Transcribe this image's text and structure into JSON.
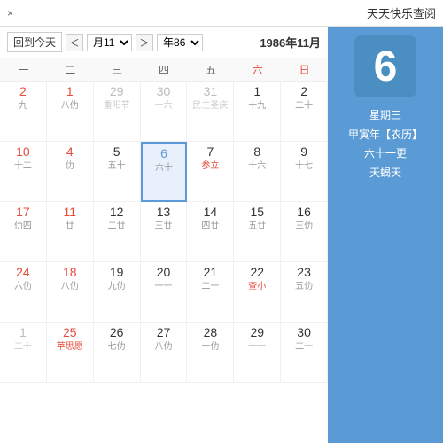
{
  "window": {
    "title": "天天快乐查阅",
    "close_label": "×"
  },
  "sidebar": {
    "big_day": "6",
    "weekday": "星期三",
    "info_line1": "【农历】甲寅年",
    "info_line2": "六十一更",
    "info_line3": "天蝎天"
  },
  "calendar": {
    "title_left": "1986年11月",
    "today_btn": "回到今天",
    "year_select": "年86",
    "month_select": "月11",
    "nav_prev": "＜",
    "nav_next": "＞",
    "weekdays": [
      {
        "label": "日",
        "is_weekend": true
      },
      {
        "label": "六",
        "is_weekend": true
      },
      {
        "label": "五",
        "is_weekend": false
      },
      {
        "label": "四",
        "is_weekend": false
      },
      {
        "label": "三",
        "is_weekend": false
      },
      {
        "label": "二",
        "is_weekend": false
      },
      {
        "label": "一",
        "is_weekend": false
      }
    ],
    "weeks": [
      [
        {
          "day": "2",
          "lunar": "二十",
          "is_weekend": false,
          "other_month": false,
          "today": false,
          "holiday": ""
        },
        {
          "day": "1",
          "lunar": "十九",
          "is_weekend": false,
          "other_month": false,
          "today": false,
          "holiday": ""
        },
        {
          "day": "31",
          "lunar": "民主圣庆",
          "is_weekend": false,
          "other_month": true,
          "today": false,
          "holiday": "民主圣庆"
        },
        {
          "day": "30",
          "lunar": "十六",
          "is_weekend": false,
          "other_month": true,
          "today": false,
          "holiday": ""
        },
        {
          "day": "29",
          "lunar": "重阳节",
          "is_weekend": false,
          "other_month": true,
          "today": false,
          "holiday": "重阳节"
        },
        {
          "day": "1",
          "lunar": "八仂",
          "is_weekend": true,
          "other_month": false,
          "today": false,
          "holiday": ""
        },
        {
          "day": "2",
          "lunar": "九",
          "is_weekend": true,
          "other_month": false,
          "today": false,
          "holiday": ""
        }
      ],
      [
        {
          "day": "9",
          "lunar": "十七",
          "is_weekend": false,
          "other_month": false,
          "today": false,
          "holiday": ""
        },
        {
          "day": "8",
          "lunar": "十六",
          "is_weekend": false,
          "other_month": false,
          "today": false,
          "holiday": ""
        },
        {
          "day": "7",
          "lunar": "参立",
          "is_weekend": false,
          "other_month": false,
          "today": false,
          "holiday": "参立"
        },
        {
          "day": "6",
          "lunar": "六十",
          "is_weekend": false,
          "other_month": false,
          "today": true,
          "holiday": ""
        },
        {
          "day": "5",
          "lunar": "五十",
          "is_weekend": false,
          "other_month": false,
          "today": false,
          "holiday": ""
        },
        {
          "day": "4",
          "lunar": "仂",
          "is_weekend": true,
          "other_month": false,
          "today": false,
          "holiday": ""
        },
        {
          "day": "10",
          "lunar": "十二",
          "is_weekend": true,
          "other_month": false,
          "today": false,
          "holiday": ""
        }
      ],
      [
        {
          "day": "16",
          "lunar": "三仂",
          "is_weekend": false,
          "other_month": false,
          "today": false,
          "holiday": ""
        },
        {
          "day": "15",
          "lunar": "五廿",
          "is_weekend": false,
          "other_month": false,
          "today": false,
          "holiday": ""
        },
        {
          "day": "14",
          "lunar": "四廿",
          "is_weekend": false,
          "other_month": false,
          "today": false,
          "holiday": ""
        },
        {
          "day": "13",
          "lunar": "三廿",
          "is_weekend": false,
          "other_month": false,
          "today": false,
          "holiday": ""
        },
        {
          "day": "12",
          "lunar": "二廿",
          "is_weekend": false,
          "other_month": false,
          "today": false,
          "holiday": ""
        },
        {
          "day": "11",
          "lunar": "廿",
          "is_weekend": true,
          "other_month": false,
          "today": false,
          "holiday": ""
        },
        {
          "day": "17",
          "lunar": "仂四",
          "is_weekend": true,
          "other_month": false,
          "today": false,
          "holiday": ""
        }
      ],
      [
        {
          "day": "23",
          "lunar": "五仂",
          "is_weekend": false,
          "other_month": false,
          "today": false,
          "holiday": ""
        },
        {
          "day": "22",
          "lunar": "查小",
          "is_weekend": false,
          "other_month": false,
          "today": false,
          "holiday": "查小"
        },
        {
          "day": "21",
          "lunar": "二一",
          "is_weekend": false,
          "other_month": false,
          "today": false,
          "holiday": ""
        },
        {
          "day": "20",
          "lunar": "一一",
          "is_weekend": false,
          "other_month": false,
          "today": false,
          "holiday": ""
        },
        {
          "day": "19",
          "lunar": "九仂",
          "is_weekend": false,
          "other_month": false,
          "today": false,
          "holiday": ""
        },
        {
          "day": "18",
          "lunar": "八仂",
          "is_weekend": true,
          "other_month": false,
          "today": false,
          "holiday": ""
        },
        {
          "day": "24",
          "lunar": "六仂",
          "is_weekend": true,
          "other_month": false,
          "today": false,
          "holiday": ""
        }
      ],
      [
        {
          "day": "30",
          "lunar": "二一",
          "is_weekend": false,
          "other_month": false,
          "today": false,
          "holiday": ""
        },
        {
          "day": "29",
          "lunar": "一一",
          "is_weekend": false,
          "other_month": false,
          "today": false,
          "holiday": ""
        },
        {
          "day": "28",
          "lunar": "十仂",
          "is_weekend": false,
          "other_month": false,
          "today": false,
          "holiday": ""
        },
        {
          "day": "27",
          "lunar": "八仂",
          "is_weekend": false,
          "other_month": false,
          "today": false,
          "holiday": ""
        },
        {
          "day": "26",
          "lunar": "七仂",
          "is_weekend": false,
          "other_month": false,
          "today": false,
          "holiday": ""
        },
        {
          "day": "25",
          "lunar": "苹思愿",
          "is_weekend": true,
          "other_month": false,
          "today": false,
          "holiday": "苹思愿"
        },
        {
          "day": "1",
          "lunar": "二十",
          "is_weekend": true,
          "other_month": true,
          "today": false,
          "holiday": ""
        }
      ]
    ]
  },
  "accent_color": "#5b9bd5",
  "today_border": "#5b9bd5",
  "holiday_color": "#e74c3c",
  "weekend_color": "#e74c3c"
}
